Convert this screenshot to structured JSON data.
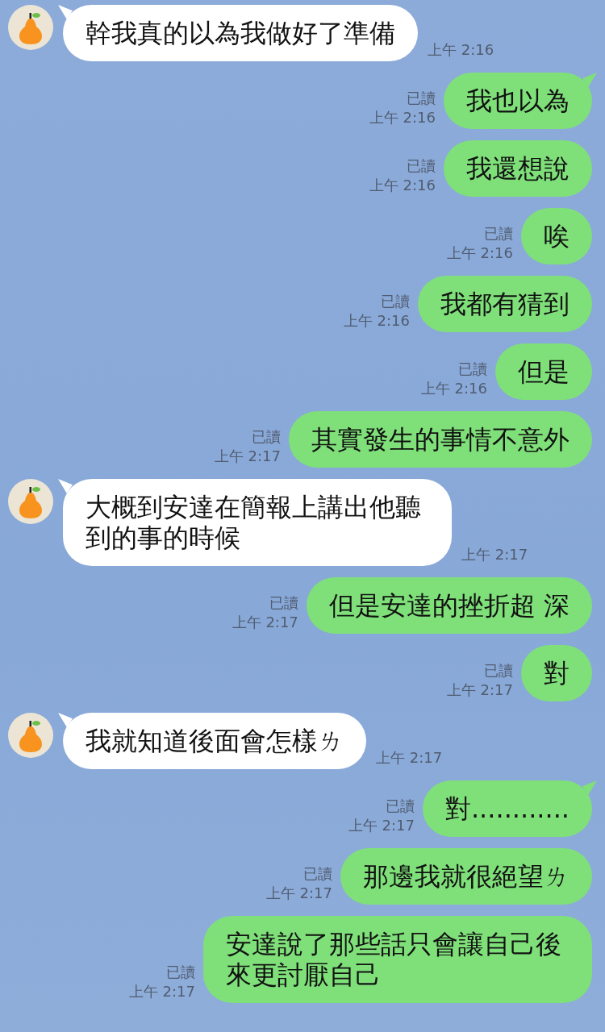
{
  "messages": [
    {
      "kind": "incoming",
      "text": "幹我真的以為我做好了準備",
      "time": "上午 2:16"
    },
    {
      "kind": "outgoing",
      "tail": true,
      "read": "已讀",
      "text": "我也以為",
      "time": "上午 2:16"
    },
    {
      "kind": "outgoing",
      "tail": false,
      "read": "已讀",
      "text": "我還想說",
      "time": "上午 2:16"
    },
    {
      "kind": "outgoing",
      "tail": false,
      "read": "已讀",
      "text": "唉",
      "time": "上午 2:16"
    },
    {
      "kind": "outgoing",
      "tail": false,
      "read": "已讀",
      "text": "我都有猜到",
      "time": "上午 2:16"
    },
    {
      "kind": "outgoing",
      "tail": false,
      "read": "已讀",
      "text": "但是",
      "time": "上午 2:16"
    },
    {
      "kind": "outgoing",
      "tail": false,
      "read": "已讀",
      "text": "其實發生的事情不意外",
      "time": "上午 2:17"
    },
    {
      "kind": "incoming",
      "text": "大概到安達在簡報上講出他聽到的事的時候",
      "time": "上午 2:17"
    },
    {
      "kind": "outgoing",
      "tail": false,
      "read": "已讀",
      "text": "但是安達的挫折超 深",
      "time": "上午 2:17"
    },
    {
      "kind": "outgoing",
      "tail": false,
      "read": "已讀",
      "text": "對",
      "time": "上午 2:17"
    },
    {
      "kind": "incoming",
      "text": "我就知道後面會怎樣ㄌ",
      "time": "上午 2:17"
    },
    {
      "kind": "outgoing",
      "tail": true,
      "read": "已讀",
      "text": "對............",
      "time": "上午 2:17"
    },
    {
      "kind": "outgoing",
      "tail": false,
      "read": "已讀",
      "text": "那邊我就很絕望ㄌ",
      "time": "上午 2:17"
    },
    {
      "kind": "outgoing",
      "tail": false,
      "read": "已讀",
      "text": "安達說了那些話只會讓自己後來更討厭自己",
      "time": "上午 2:17"
    }
  ]
}
